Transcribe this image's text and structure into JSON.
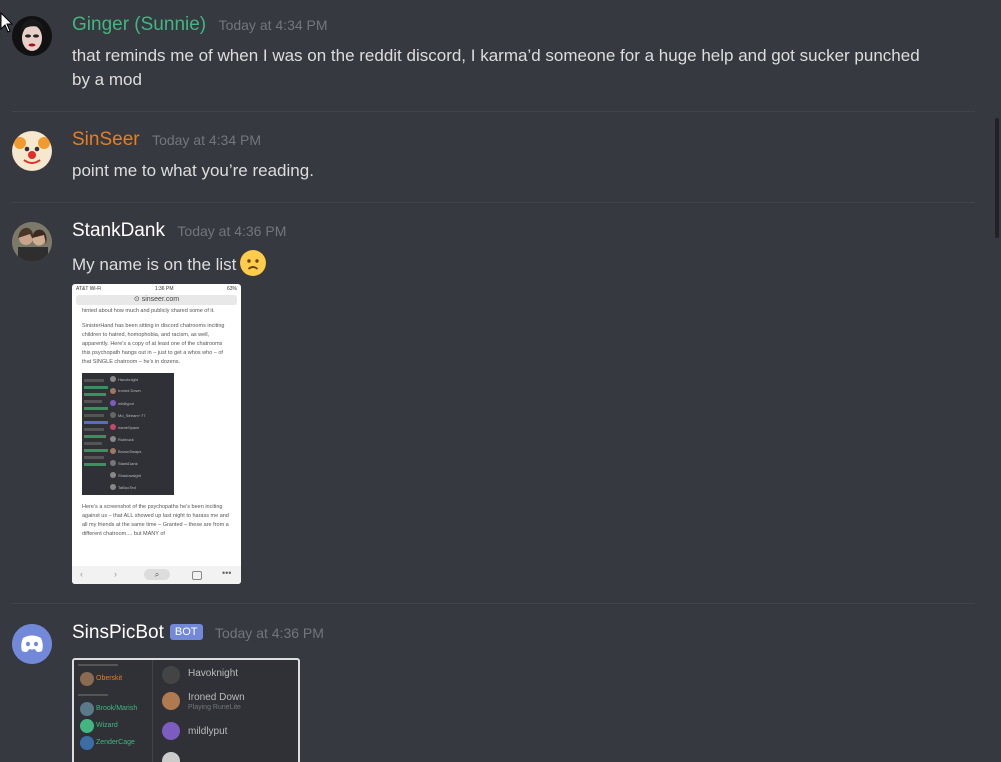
{
  "messages": [
    {
      "username": "Ginger (Sunnie)",
      "user_color": "#43b581",
      "timestamp": "Today at 4:34 PM",
      "text": "that reminds me of when I was on the reddit discord, I karma’d someone for a huge help and got sucker punched by a mod"
    },
    {
      "username": "SinSeer",
      "user_color": "#e67e22",
      "timestamp": "Today at 4:34 PM",
      "text": "point me to what you’re reading."
    },
    {
      "username": "StankDank",
      "user_color": "#ffffff",
      "timestamp": "Today at 4:36 PM",
      "text": "My name is on the list",
      "emoji": "frowning-face",
      "attachment": {
        "status_carrier": "AT&T Wi-Fi",
        "status_time": "1:36 PM",
        "status_battery": "63%",
        "url": "sinseer.com",
        "para0": "hinted about how much and publicly shared some of it.",
        "para1": "SinisterHand has been sitting in discord chatrooms inciting children to hatred, homophobia, and racism, as well, apparently. Here’s a copy of at least one of the chatrooms this psychopath hangs out in – just to get a whos who – of that SINGLE chatroom – he’s in dozens.",
        "list_names": [
          "Havoknight",
          "Ironed Down",
          "mildlyput",
          "Mo_Stream~77",
          "nameSpace",
          "Rubbuck",
          "BrownSwaps",
          "StankDank",
          "Shadowsight",
          "TaBooTed"
        ],
        "para2": "Here’s a screenshot of the psychopaths he’s been inciting against us – that ALL showed up last night to harass me and all my friends at the same time – Granted – these are from a different chatroom.... but MANY of"
      }
    },
    {
      "username": "SinsPicBot",
      "user_color": "#ffffff",
      "bot_tag": "BOT",
      "timestamp": "Today at 4:36 PM",
      "attachment": {
        "left_names": [
          "Oberskit",
          "Brook/Marish",
          "Wizard",
          "ZenderCage"
        ],
        "right_names": [
          "Havoknight",
          "Ironed Down",
          "mildlyput"
        ],
        "right_sub": "Playing RuneLite"
      }
    }
  ],
  "colors": {
    "background": "#36393f",
    "bot_tag": "#7289da",
    "timestamp": "#72767d"
  }
}
